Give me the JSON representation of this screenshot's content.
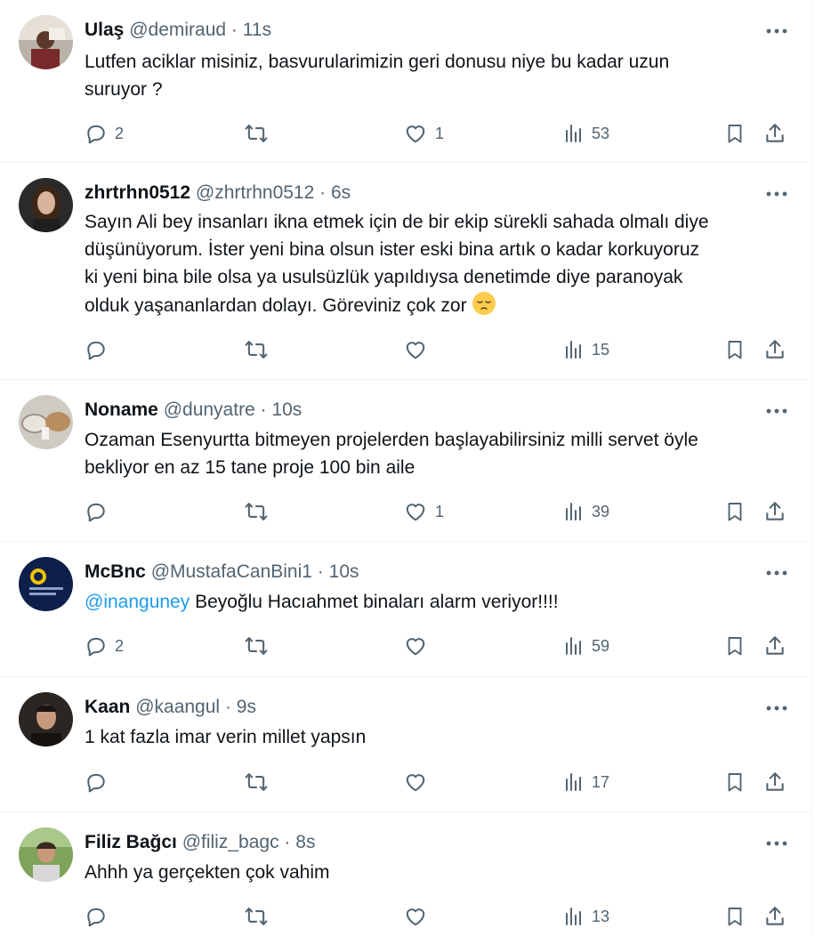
{
  "tweets": [
    {
      "name": "Ulaş",
      "handle": "@demiraud",
      "separator": "·",
      "time": "11s",
      "text_lines": [
        "Lutfen aciklar misiniz, basvurularimizin geri donusu niye bu kadar uzun",
        "suruyor  ?"
      ],
      "replies": "2",
      "likes": "1",
      "views": "53"
    },
    {
      "name": "zhrtrhn0512",
      "handle": "@zhrtrhn0512",
      "separator": "·",
      "time": "6s",
      "text_lines": [
        "Sayın Ali bey insanları ikna etmek için de bir ekip sürekli sahada olmalı diye",
        "düşünüyorum. İster yeni bina olsun ister eski bina artık o kadar korkuyoruz",
        "ki yeni bina bile olsa ya usulsüzlük yapıldıysa denetimde diye paranoyak",
        "olduk yaşananlardan dolayı. Göreviniz çok zor"
      ],
      "emoji": "pensive-face-emoji",
      "replies": "",
      "likes": "",
      "views": "15"
    },
    {
      "name": "Noname",
      "handle": "@dunyatre",
      "separator": "·",
      "time": "10s",
      "text_lines": [
        "Ozaman Esenyurtta bitmeyen projelerden başlayabilirsiniz milli servet öyle",
        "bekliyor en az 15 tane proje 100 bin aile"
      ],
      "replies": "",
      "likes": "1",
      "views": "39"
    },
    {
      "name": "McBnc",
      "handle": "@MustafaCanBini1",
      "separator": "·",
      "time": "10s",
      "mention": "@inanguney",
      "text_lines": [
        " Beyoğlu Hacıahmet binaları alarm veriyor!!!!"
      ],
      "replies": "2",
      "likes": "",
      "views": "59"
    },
    {
      "name": "Kaan",
      "handle": "@kaangul",
      "separator": "·",
      "time": "9s",
      "text_lines": [
        "1 kat fazla imar verin millet yapsın"
      ],
      "replies": "",
      "likes": "",
      "views": "17"
    },
    {
      "name": "Filiz Bağcı",
      "handle": "@filiz_bagc",
      "separator": "·",
      "time": "8s",
      "text_lines": [
        "Ahhh ya gerçekten çok vahim"
      ],
      "replies": "",
      "likes": "",
      "views": "13"
    }
  ],
  "icons": [
    "more-icon",
    "reply-icon",
    "retweet-icon",
    "like-icon",
    "views-icon",
    "bookmark-icon",
    "share-icon"
  ],
  "colors": {
    "text": "#0f1419",
    "secondary": "#536471",
    "mention": "#1d9bf0",
    "divider": "#eff3f4"
  }
}
